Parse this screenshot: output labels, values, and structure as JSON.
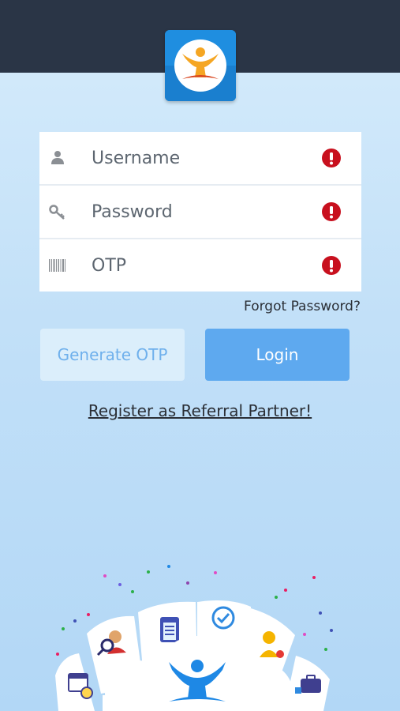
{
  "login": {
    "fields": [
      {
        "placeholder": "Username",
        "icon": "user-icon"
      },
      {
        "placeholder": "Password",
        "icon": "key-icon"
      },
      {
        "placeholder": "OTP",
        "icon": "barcode-icon"
      }
    ],
    "forgot_password": "Forgot Password?",
    "generate_otp": "Generate OTP",
    "login_button": "Login",
    "register_link": "Register as Referral Partner!"
  },
  "colors": {
    "header": "#2a3546",
    "accent": "#5ea9ef",
    "alert": "#c8101e",
    "background": "#c2e0f8"
  }
}
